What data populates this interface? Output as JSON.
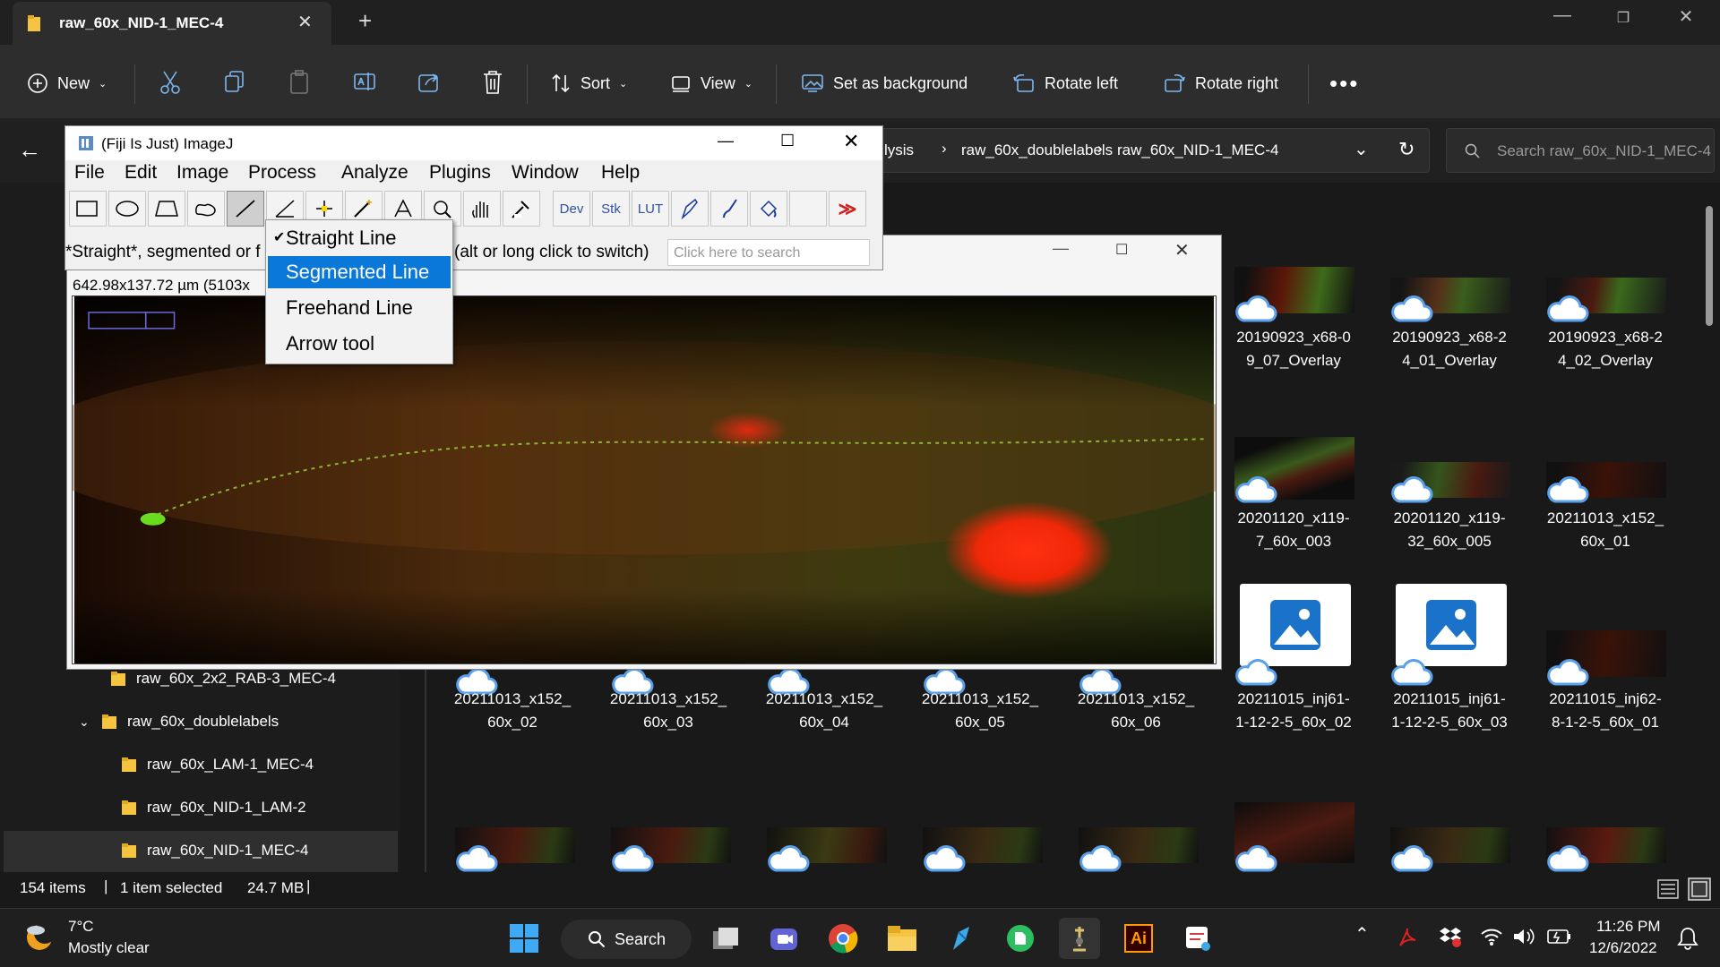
{
  "explorer": {
    "tab_title": "raw_60x_NID-1_MEC-4",
    "commands": {
      "new": "New",
      "sort": "Sort",
      "view": "View",
      "set_background": "Set as background",
      "rotate_left": "Rotate left",
      "rotate_right": "Rotate right"
    },
    "breadcrumb": [
      "lysis",
      "raw_60x_doublelabels",
      "raw_60x_NID-1_MEC-4"
    ],
    "search_placeholder": "Search raw_60x_NID-1_MEC-4",
    "tree": [
      {
        "label": "raw_60x_2x2_RAB-3_MEC-4"
      },
      {
        "label": "raw_60x_doublelabels"
      },
      {
        "label": "raw_60x_LAM-1_MEC-4"
      },
      {
        "label": "raw_60x_NID-1_LAM-2"
      },
      {
        "label": "raw_60x_NID-1_MEC-4"
      }
    ],
    "files_row1": [
      {
        "name1": "20190923_x68-0",
        "name2": "9_07_Overlay"
      },
      {
        "name1": "20190923_x68-2",
        "name2": "4_01_Overlay"
      },
      {
        "name1": "20190923_x68-2",
        "name2": "4_02_Overlay"
      }
    ],
    "files_row2": [
      {
        "name1": "20201120_x119-",
        "name2": "7_60x_003"
      },
      {
        "name1": "20201120_x119-",
        "name2": "32_60x_005"
      },
      {
        "name1": "20211013_x152_",
        "name2": "60x_01"
      }
    ],
    "files_row3": [
      {
        "name1": "20211013_x152_",
        "name2": "60x_02"
      },
      {
        "name1": "20211013_x152_",
        "name2": "60x_03"
      },
      {
        "name1": "20211013_x152_",
        "name2": "60x_04"
      },
      {
        "name1": "20211013_x152_",
        "name2": "60x_05"
      },
      {
        "name1": "20211013_x152_",
        "name2": "60x_06"
      },
      {
        "name1": "20211015_inj61-",
        "name2": "1-12-2-5_60x_02"
      },
      {
        "name1": "20211015_inj61-",
        "name2": "1-12-2-5_60x_03"
      },
      {
        "name1": "20211015_inj62-",
        "name2": "8-1-2-5_60x_01"
      }
    ],
    "status": {
      "items": "154 items",
      "selected": "1 item selected",
      "size": "24.7 MB"
    }
  },
  "imagej": {
    "title": "(Fiji Is Just) ImageJ",
    "menu": [
      "File",
      "Edit",
      "Image",
      "Process",
      "Analyze",
      "Plugins",
      "Window",
      "Help"
    ],
    "tool_text": {
      "dev": "Dev",
      "stk": "Stk",
      "lut": "LUT"
    },
    "status_left": "*Straight*, segmented or f",
    "status_right": "(alt or long click to switch)",
    "search_placeholder": "Click here to search",
    "image_info": "642.98x137.72 µm (5103x",
    "line_menu": [
      {
        "label": "Straight Line",
        "checked": true
      },
      {
        "label": "Segmented Line",
        "highlighted": true
      },
      {
        "label": "Freehand Line"
      },
      {
        "label": "Arrow tool"
      }
    ]
  },
  "taskbar": {
    "weather_temp": "7°C",
    "weather_desc": "Mostly clear",
    "search_label": "Search",
    "time": "11:26 PM",
    "date": "12/6/2022"
  },
  "colors": {
    "accent": "#0078d7",
    "highlight": "#0a78d8",
    "cloud": "#5aa0ea"
  }
}
